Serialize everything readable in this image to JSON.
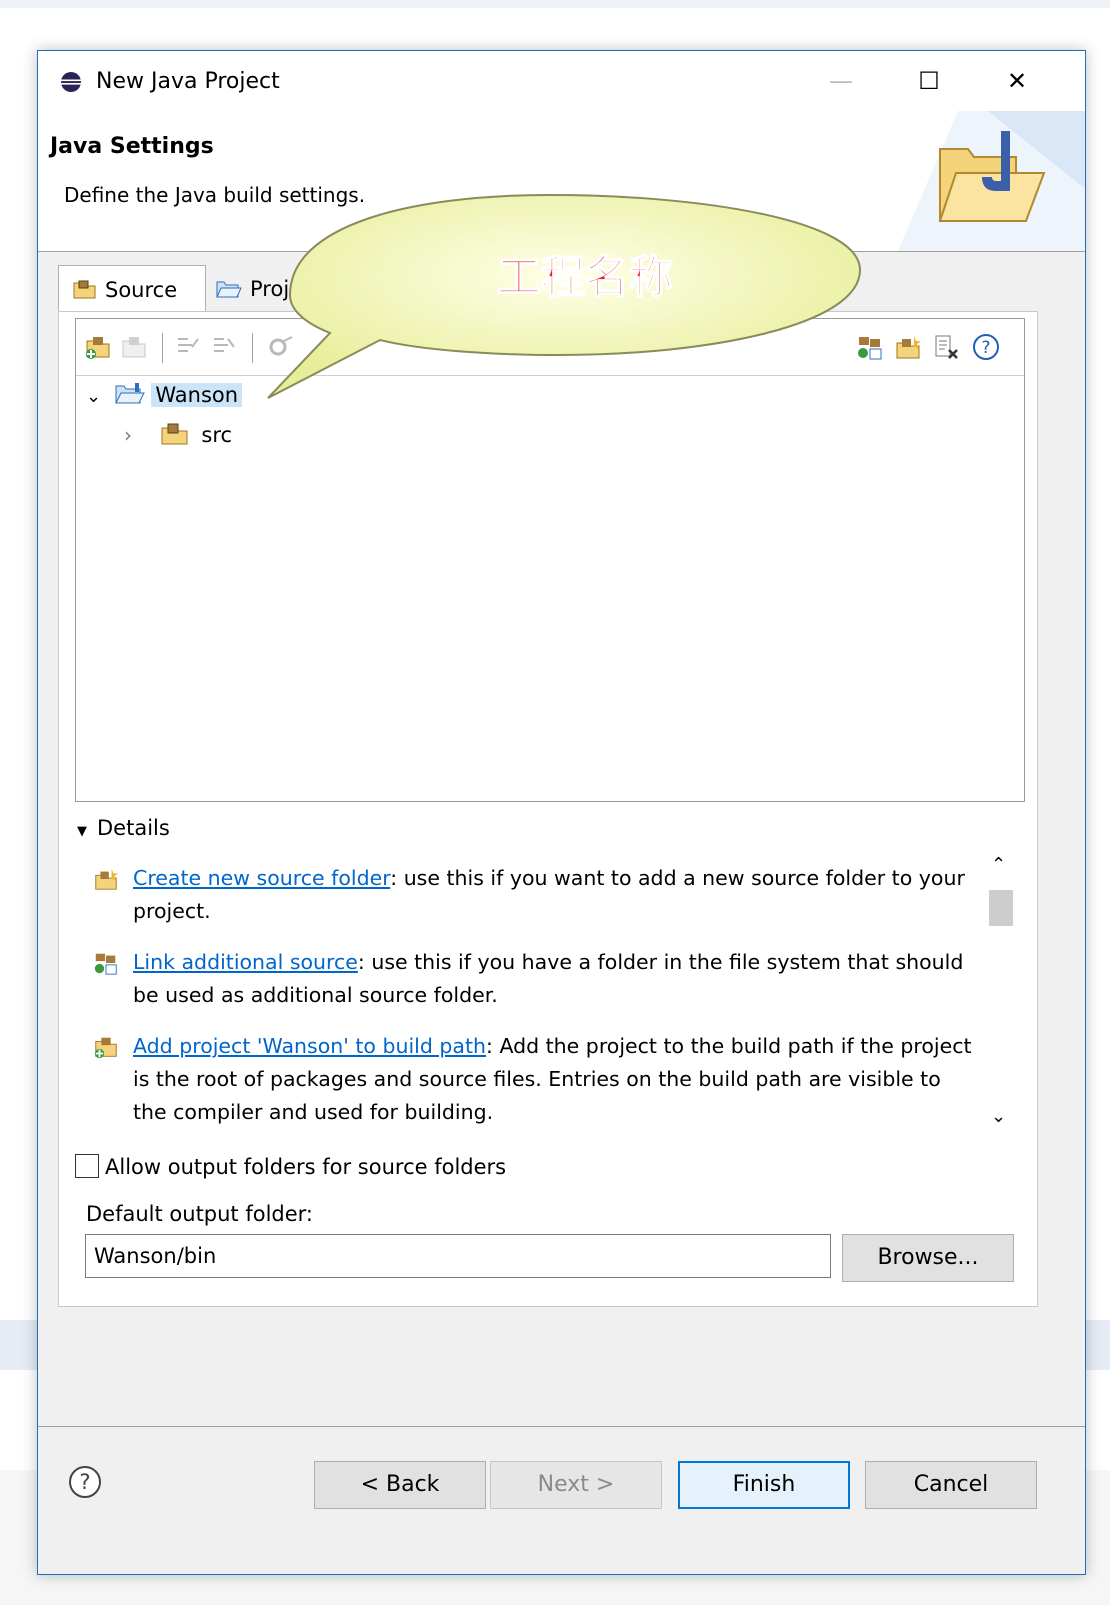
{
  "window": {
    "title": "New Java Project",
    "minimize_glyph": "—",
    "maximize_glyph": "☐",
    "close_glyph": "✕"
  },
  "header": {
    "title": "Java Settings",
    "description": "Define the Java build settings."
  },
  "tabs": [
    {
      "label": "Source",
      "icon": "source-folder-icon",
      "active": true
    },
    {
      "label": "Projects",
      "icon": "project-folder-icon",
      "active": false
    }
  ],
  "toolbar": {
    "left_icons": [
      "add-project-to-build-path-icon",
      "remove-from-build-path-icon",
      "include-icon",
      "exclude-icon",
      "configure-icon"
    ],
    "right_icons": [
      "link-source-icon",
      "create-source-folder-icon",
      "configure-build-path-icon",
      "help-icon"
    ]
  },
  "tree": {
    "project": "Wanson",
    "children": [
      {
        "label": "src"
      }
    ]
  },
  "callout": {
    "text": "工程名称"
  },
  "details": {
    "header": "Details",
    "items": [
      {
        "link": "Create new source folder",
        "text": ": use this if you want to add a new source folder to your project.",
        "icon": "create-source-folder-icon"
      },
      {
        "link": "Link additional source",
        "text": ": use this if you have a folder in the file system that should be used as additional source folder.",
        "icon": "link-source-icon"
      },
      {
        "link": "Add project 'Wanson' to build path",
        "text": ": Add the project to the build path if the project is the root of packages and source files. Entries on the build path are visible to the compiler and used for building.",
        "icon": "add-project-to-build-path-icon"
      }
    ]
  },
  "options": {
    "allow_output_folders_label": "Allow output folders for source folders",
    "allow_output_folders_checked": false,
    "default_output_label": "Default output folder:",
    "default_output_value": "Wanson/bin",
    "browse_label": "Browse..."
  },
  "buttons": {
    "back": "< Back",
    "next": "Next >",
    "finish": "Finish",
    "cancel": "Cancel"
  },
  "colors": {
    "accent": "#0078d7",
    "link": "#0066cc",
    "callout_fill": "#f2f5b0",
    "callout_text": "#e8231e"
  }
}
